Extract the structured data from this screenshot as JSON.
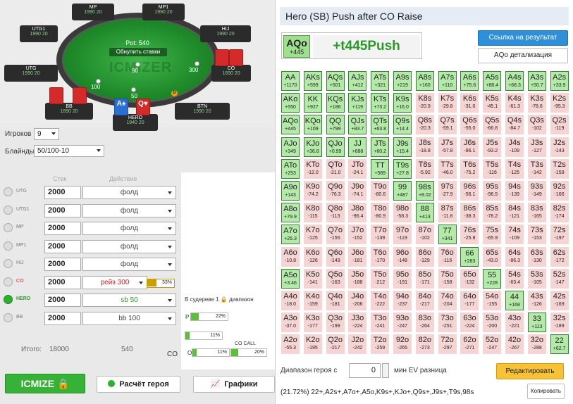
{
  "table": {
    "pot_label": "Pot: 540",
    "reset_label": "Обнулить ставки",
    "logo": "ICMIZER",
    "seats": [
      {
        "name": "MP",
        "pos": "MP",
        "stack": "1990 20"
      },
      {
        "name": "MP1",
        "pos": "MP1",
        "stack": "1990 20"
      },
      {
        "name": "UTG1",
        "pos": "UTG1",
        "stack": "1990 20"
      },
      {
        "name": "HIJ",
        "pos": "HIJ",
        "stack": "1990 20"
      },
      {
        "name": "UTG",
        "pos": "UTG",
        "stack": "1990 20"
      },
      {
        "name": "CO",
        "pos": "CO",
        "stack": "1690 20"
      },
      {
        "name": "BB",
        "pos": "BB",
        "stack": "1890 20"
      },
      {
        "name": "BTN",
        "pos": "BTN",
        "stack": "1990 20"
      },
      {
        "name": "HERO",
        "pos": "SB",
        "stack": "1940 20"
      }
    ],
    "bets": {
      "b90": "90",
      "b300": "300",
      "b100": "100",
      "b50": "50"
    },
    "hero_cards": [
      "A♠",
      "Q♥"
    ],
    "dealer": "D"
  },
  "settings": {
    "players_label": "Игроков",
    "players_value": "9",
    "blinds_label": "Блайнды",
    "blinds_value": "50/100-10"
  },
  "columns": {
    "stack": "Стек",
    "action": "Действие"
  },
  "players": [
    {
      "pos": "UTG",
      "stack": "2000",
      "action": "фолд",
      "cls": ""
    },
    {
      "pos": "UTG1",
      "stack": "2000",
      "action": "фолд",
      "cls": ""
    },
    {
      "pos": "MP",
      "stack": "2000",
      "action": "фолд",
      "cls": ""
    },
    {
      "pos": "MP1",
      "stack": "2000",
      "action": "фолд",
      "cls": ""
    },
    {
      "pos": "HIJ",
      "stack": "2000",
      "action": "фолд",
      "cls": ""
    },
    {
      "pos": "CO",
      "stack": "2000",
      "action": "рейз 300",
      "cls": "red"
    },
    {
      "pos": "HERO",
      "stack": "2000",
      "action": "sb 50",
      "cls": "green"
    },
    {
      "pos": "BB",
      "stack": "2000",
      "action": "bb 100",
      "cls": ""
    }
  ],
  "co_range_pct": "33%",
  "totals": {
    "label": "Итого:",
    "stack": "18000",
    "pot": "540"
  },
  "subtree": {
    "text": "В судереве 1 🔒 диапазон",
    "p_label": "P",
    "p_val": "22%",
    "p_frac": 0.22,
    "v2": "11%",
    "v2_frac": 0.11,
    "o_label": "O",
    "o_val": "11%",
    "o_frac": 0.11,
    "co_call": "CO CALL",
    "co_val": "20%",
    "co_frac": 0.2,
    "co_text": "CO"
  },
  "buttons": {
    "icmize": "ICMIZE",
    "hero_calc": "Расчёт героя",
    "charts": "Графики"
  },
  "panel": {
    "title": "Hero (SB) Push after CO Raise",
    "hand": "AQo",
    "hand_ev": "+445",
    "big_ev": "+t445Push",
    "link_btn": "Ссылка на результат",
    "detail_btn": "AQo детализация",
    "range_label": "Диапазон героя с",
    "range_value": "0",
    "ev_label": "мин EV разница",
    "edit_btn": "Редактировать",
    "range_text": "(21.72%) 22+,A2s+,A7o+,A5o,K9s+,KJo+,Q9s+,J9s+,T9s,98s",
    "copy_btn": "Копировать"
  },
  "grid": [
    [
      [
        "AA",
        "+1170"
      ],
      [
        "AKs",
        "+599"
      ],
      [
        "AQs",
        "+501"
      ],
      [
        "AJs",
        "+412"
      ],
      [
        "ATs",
        "+321"
      ],
      [
        "A9s",
        "+219"
      ],
      [
        "A8s",
        "+160"
      ],
      [
        "A7s",
        "+110"
      ],
      [
        "A6s",
        "+75.6"
      ],
      [
        "A5s",
        "+88.4"
      ],
      [
        "A4s",
        "+68.3"
      ],
      [
        "A3s",
        "+50.7"
      ],
      [
        "A2s",
        "+33.9"
      ]
    ],
    [
      [
        "AKo",
        "+550"
      ],
      [
        "KK",
        "+927"
      ],
      [
        "KQs",
        "+186"
      ],
      [
        "KJs",
        "+119"
      ],
      [
        "KTs",
        "+73.2"
      ],
      [
        "K9s",
        "+16.0"
      ],
      [
        "K8s",
        "-20.9"
      ],
      [
        "K7s",
        "-29.8"
      ],
      [
        "K6s",
        "-31.0"
      ],
      [
        "K5s",
        "-45.1"
      ],
      [
        "K4s",
        "-61.3"
      ],
      [
        "K3s",
        "-78.6"
      ],
      [
        "K2s",
        "-95.3"
      ]
    ],
    [
      [
        "AQo",
        "+445"
      ],
      [
        "KQo",
        "+109"
      ],
      [
        "QQ",
        "+799"
      ],
      [
        "QJs",
        "+83.7"
      ],
      [
        "QTs",
        "+63.8"
      ],
      [
        "Q9s",
        "+14.4"
      ],
      [
        "Q8s",
        "-20.3"
      ],
      [
        "Q7s",
        "-59.1"
      ],
      [
        "Q6s",
        "-55.0"
      ],
      [
        "Q5s",
        "-66.8"
      ],
      [
        "Q4s",
        "-84.7"
      ],
      [
        "Q3s",
        "-102"
      ],
      [
        "Q2s",
        "-119"
      ]
    ],
    [
      [
        "AJo",
        "+349"
      ],
      [
        "KJo",
        "+36.8"
      ],
      [
        "QJo",
        "+0.99"
      ],
      [
        "JJ",
        "+688"
      ],
      [
        "JTs",
        "+60.2"
      ],
      [
        "J9s",
        "+15.4"
      ],
      [
        "J8s",
        "-18.8"
      ],
      [
        "J7s",
        "-57.8"
      ],
      [
        "J6s",
        "-86.1"
      ],
      [
        "J5s",
        "-93.2"
      ],
      [
        "J4s",
        "-109"
      ],
      [
        "J3s",
        "-127"
      ],
      [
        "J2s",
        "-143"
      ]
    ],
    [
      [
        "ATo",
        "+253"
      ],
      [
        "KTo",
        "-12.0"
      ],
      [
        "QTo",
        "-21.0"
      ],
      [
        "JTo",
        "-24.1"
      ],
      [
        "TT",
        "+589"
      ],
      [
        "T9s",
        "+27.8"
      ],
      [
        "T8s",
        "-5.92"
      ],
      [
        "T7s",
        "-46.0"
      ],
      [
        "T6s",
        "-75.2"
      ],
      [
        "T5s",
        "-116"
      ],
      [
        "T4s",
        "-125"
      ],
      [
        "T3s",
        "-142"
      ],
      [
        "T2s",
        "-159"
      ]
    ],
    [
      [
        "A9o",
        "+143"
      ],
      [
        "K9o",
        "-74.2"
      ],
      [
        "Q9o",
        "-76.3"
      ],
      [
        "J9o",
        "-74.1"
      ],
      [
        "T9o",
        "-60.6"
      ],
      [
        "99",
        "+487"
      ],
      [
        "98s",
        "+8.02"
      ],
      [
        "97s",
        "-27.9"
      ],
      [
        "96s",
        "-56.1"
      ],
      [
        "95s",
        "-96.5"
      ],
      [
        "94s",
        "-139"
      ],
      [
        "93s",
        "-149"
      ],
      [
        "92s",
        "-166"
      ]
    ],
    [
      [
        "A8o",
        "+79.9"
      ],
      [
        "K8o",
        "-115"
      ],
      [
        "Q8o",
        "-113"
      ],
      [
        "J8o",
        "-96.4"
      ],
      [
        "T8o",
        "-80.9"
      ],
      [
        "98o",
        "-58.3"
      ],
      [
        "88",
        "+413"
      ],
      [
        "87s",
        "-11.8"
      ],
      [
        "86s",
        "-38.3"
      ],
      [
        "85s",
        "-78.2"
      ],
      [
        "84s",
        "-121"
      ],
      [
        "83s",
        "-165"
      ],
      [
        "82s",
        "-174"
      ]
    ],
    [
      [
        "A7o",
        "+25.3"
      ],
      [
        "K7o",
        "-125"
      ],
      [
        "Q7o",
        "-155"
      ],
      [
        "J7o",
        "-152"
      ],
      [
        "T7o",
        "-139"
      ],
      [
        "97o",
        "-119"
      ],
      [
        "87o",
        "-102"
      ],
      [
        "77",
        "+341"
      ],
      [
        "76s",
        "-25.8"
      ],
      [
        "75s",
        "-65.9"
      ],
      [
        "74s",
        "-109"
      ],
      [
        "73s",
        "-153"
      ],
      [
        "72s",
        "-197"
      ]
    ],
    [
      [
        "A6o",
        "-10.8"
      ],
      [
        "K6o",
        "-126"
      ],
      [
        "Q6o",
        "-149"
      ],
      [
        "J6o",
        "-181"
      ],
      [
        "T6o",
        "-170"
      ],
      [
        "96o",
        "-148"
      ],
      [
        "86o",
        "-129"
      ],
      [
        "76o",
        "-116"
      ],
      [
        "66",
        "+283"
      ],
      [
        "65s",
        "-43.0"
      ],
      [
        "64s",
        "-86.3"
      ],
      [
        "63s",
        "-130"
      ],
      [
        "62s",
        "-172"
      ]
    ],
    [
      [
        "A5o",
        "+3.46"
      ],
      [
        "K5o",
        "-141"
      ],
      [
        "Q5o",
        "-163"
      ],
      [
        "J5o",
        "-188"
      ],
      [
        "T5o",
        "-212"
      ],
      [
        "95o",
        "-191"
      ],
      [
        "85o",
        "-171"
      ],
      [
        "75o",
        "-158"
      ],
      [
        "65o",
        "-132"
      ],
      [
        "55",
        "+228"
      ],
      [
        "54s",
        "-63.4"
      ],
      [
        "53s",
        "-105"
      ],
      [
        "52s",
        "-147"
      ]
    ],
    [
      [
        "A4o",
        "-18.0"
      ],
      [
        "K4o",
        "-159"
      ],
      [
        "Q4o",
        "-181"
      ],
      [
        "J4o",
        "-206"
      ],
      [
        "T4o",
        "-222"
      ],
      [
        "94o",
        "-237"
      ],
      [
        "84o",
        "-217"
      ],
      [
        "74o",
        "-204"
      ],
      [
        "64o",
        "-177"
      ],
      [
        "54o",
        "-155"
      ],
      [
        "44",
        "+168"
      ],
      [
        "43s",
        "-126"
      ],
      [
        "42s",
        "-169"
      ]
    ],
    [
      [
        "A3o",
        "-37.0"
      ],
      [
        "K3o",
        "-177"
      ],
      [
        "Q3o",
        "-199"
      ],
      [
        "J3o",
        "-224"
      ],
      [
        "T3o",
        "-241"
      ],
      [
        "93o",
        "-247"
      ],
      [
        "83o",
        "-264"
      ],
      [
        "73o",
        "-251"
      ],
      [
        "63o",
        "-224"
      ],
      [
        "53o",
        "-200"
      ],
      [
        "43o",
        "-221"
      ],
      [
        "33",
        "+113"
      ],
      [
        "32s",
        "-189"
      ]
    ],
    [
      [
        "A2o",
        "-55.3"
      ],
      [
        "K2o",
        "-195"
      ],
      [
        "Q2o",
        "-217"
      ],
      [
        "J2o",
        "-242"
      ],
      [
        "T2o",
        "-259"
      ],
      [
        "92o",
        "-265"
      ],
      [
        "82o",
        "-273"
      ],
      [
        "72o",
        "-297"
      ],
      [
        "62o",
        "-271"
      ],
      [
        "52o",
        "-247"
      ],
      [
        "42o",
        "-267"
      ],
      [
        "32o",
        "-288"
      ],
      [
        "22",
        "+62.7"
      ]
    ]
  ]
}
